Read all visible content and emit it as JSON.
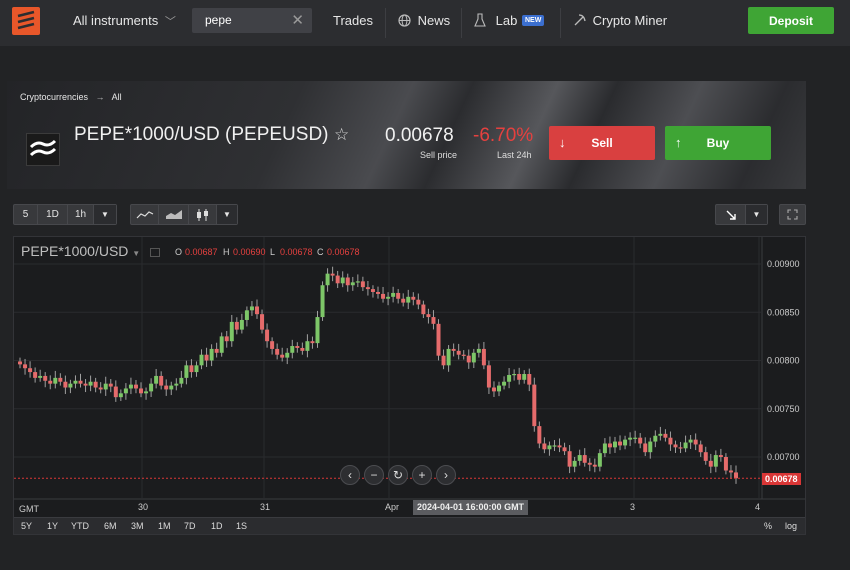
{
  "nav": {
    "instruments_label": "All instruments",
    "search_value": "pepe",
    "trades_label": "Trades",
    "news_label": "News",
    "lab_label": "Lab",
    "lab_badge": "NEW",
    "crypto_miner_label": "Crypto Miner",
    "deposit_label": "Deposit"
  },
  "instrument": {
    "breadcrumb_1": "Cryptocurrencies",
    "breadcrumb_sep": "→",
    "breadcrumb_2": "All",
    "title": "PEPE*1000/USD (PEPEUSD)",
    "price": "0.00678",
    "price_label": "Sell price",
    "change": "-6.70%",
    "change_label": "Last 24h",
    "sell_label": "Sell",
    "buy_label": "Buy"
  },
  "toolbar": {
    "intervals": [
      "5",
      "1D",
      "1h"
    ],
    "chart_types": [
      "line-chart-icon",
      "area-chart-icon",
      "candlestick-icon"
    ]
  },
  "chart": {
    "symbol": "PEPE*1000/USD",
    "ohlc": {
      "o_label": "O",
      "o": "0.00687",
      "h_label": "H",
      "h": "0.00690",
      "l_label": "L",
      "l": "0.00678",
      "c_label": "C",
      "c": "0.00678"
    },
    "crosshair_label": "2024-04-01 16:00:00 GMT",
    "last_price_label": "0.00678",
    "timezone": "GMT",
    "x_ticks": [
      "30",
      "31",
      "Apr",
      "3",
      "4"
    ],
    "y_ticks": [
      "0.00900",
      "0.00850",
      "0.00800",
      "0.00750",
      "0.00700"
    ],
    "ranges": [
      "5Y",
      "1Y",
      "YTD",
      "6M",
      "3M",
      "1M",
      "7D",
      "1D",
      "1S"
    ],
    "scale_options": [
      "%",
      "log"
    ]
  },
  "chart_data": {
    "type": "candlestick",
    "symbol": "PEPE*1000/USD",
    "interval": "1h",
    "ylim": [
      0.0066,
      0.0091
    ],
    "y_ticks": [
      0.009,
      0.0085,
      0.008,
      0.0075,
      0.007
    ],
    "x_ticks": [
      "30",
      "31",
      "Apr",
      "3",
      "4"
    ],
    "last_price": 0.00678,
    "close": [
      0.00796,
      0.00792,
      0.00788,
      0.00782,
      0.00784,
      0.00779,
      0.00776,
      0.00782,
      0.00778,
      0.00772,
      0.00776,
      0.00779,
      0.00776,
      0.00774,
      0.00778,
      0.00772,
      0.0077,
      0.00776,
      0.00773,
      0.00762,
      0.00766,
      0.00771,
      0.00775,
      0.00771,
      0.00766,
      0.00768,
      0.00776,
      0.00784,
      0.00774,
      0.0077,
      0.00774,
      0.00776,
      0.00782,
      0.00795,
      0.00788,
      0.00795,
      0.00806,
      0.008,
      0.00812,
      0.00808,
      0.00825,
      0.0082,
      0.0084,
      0.00832,
      0.00842,
      0.00852,
      0.00856,
      0.00848,
      0.00832,
      0.0082,
      0.00812,
      0.00806,
      0.00803,
      0.00808,
      0.00815,
      0.00813,
      0.0081,
      0.0082,
      0.00818,
      0.00845,
      0.00878,
      0.0089,
      0.00888,
      0.0088,
      0.00886,
      0.00878,
      0.00881,
      0.00882,
      0.00876,
      0.00874,
      0.00871,
      0.00869,
      0.00864,
      0.00866,
      0.0087,
      0.00864,
      0.0086,
      0.00866,
      0.00863,
      0.00858,
      0.00848,
      0.00845,
      0.00838,
      0.00805,
      0.00795,
      0.00812,
      0.0081,
      0.00806,
      0.00805,
      0.00798,
      0.00808,
      0.00812,
      0.00795,
      0.00772,
      0.00768,
      0.00774,
      0.00778,
      0.00785,
      0.00786,
      0.0078,
      0.00786,
      0.00775,
      0.00732,
      0.00714,
      0.00708,
      0.00712,
      0.00712,
      0.0071,
      0.00706,
      0.0069,
      0.00696,
      0.00702,
      0.00694,
      0.00692,
      0.0069,
      0.00704,
      0.00714,
      0.0071,
      0.00716,
      0.00712,
      0.00718,
      0.0072,
      0.0072,
      0.00714,
      0.00705,
      0.00716,
      0.00722,
      0.00724,
      0.0072,
      0.00713,
      0.0071,
      0.00709,
      0.00715,
      0.00718,
      0.00713,
      0.00705,
      0.00696,
      0.0069,
      0.00702,
      0.007,
      0.00686,
      0.00684,
      0.00678
    ]
  }
}
